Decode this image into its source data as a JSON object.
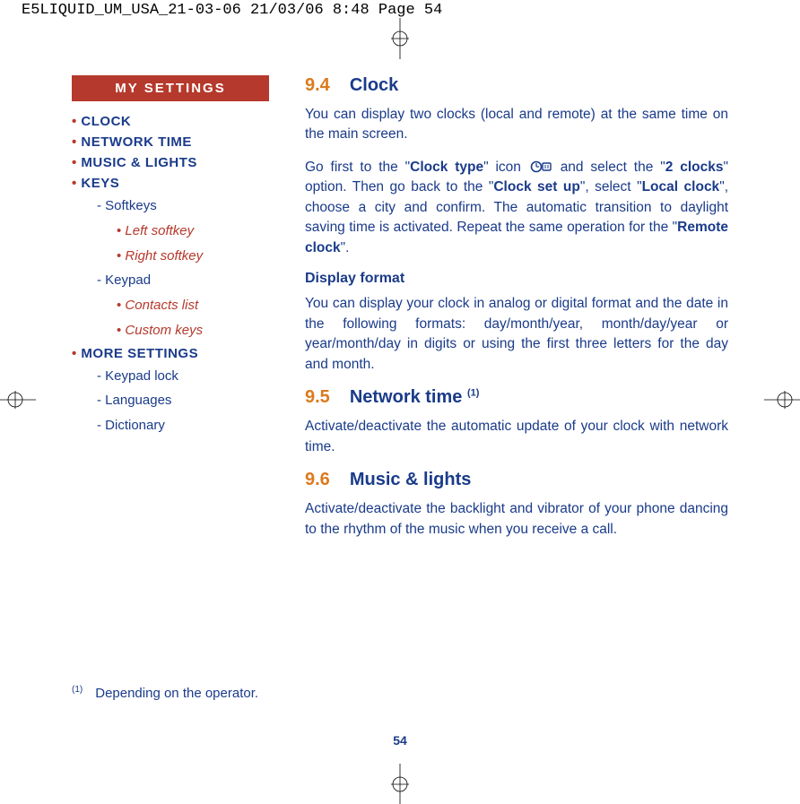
{
  "header_line": "E5LIQUID_UM_USA_21-03-06  21/03/06  8:48  Page 54",
  "sidebar": {
    "tab": "MY SETTINGS",
    "items": [
      {
        "label": "CLOCK",
        "level": 1
      },
      {
        "label": "NETWORK TIME",
        "level": 1
      },
      {
        "label": "MUSIC & LIGHTS",
        "level": 1
      },
      {
        "label": "KEYS",
        "level": 1
      },
      {
        "label": "Softkeys",
        "level": 2
      },
      {
        "label": "Left softkey",
        "level": 3
      },
      {
        "label": "Right softkey",
        "level": 3
      },
      {
        "label": "Keypad",
        "level": 2
      },
      {
        "label": "Contacts list",
        "level": 3
      },
      {
        "label": "Custom keys",
        "level": 3
      },
      {
        "label": "MORE SETTINGS",
        "level": 1
      },
      {
        "label": "Keypad lock",
        "level": 2
      },
      {
        "label": "Languages",
        "level": 2
      },
      {
        "label": "Dictionary",
        "level": 2
      }
    ]
  },
  "sections": {
    "s94": {
      "num": "9.4",
      "title": "Clock",
      "p1": "You can display two clocks (local and remote) at the same time on the main screen.",
      "p2a": "Go first to the \"",
      "p2b": "Clock type",
      "p2c": "\" icon ",
      "p2d": " and select the \"",
      "p2e": "2 clocks",
      "p2f": "\" option. Then go back to the \"",
      "p2g": "Clock set up",
      "p2h": "\", select \"",
      "p2i": "Local clock",
      "p2j": "\", choose a city and confirm. The automatic transition to daylight saving time is activated. Repeat the same operation for the \"",
      "p2k": "Remote clock",
      "p2l": "\".",
      "h3": "Display format",
      "p3": "You can display your clock in analog or digital format and the date in the following formats: day/month/year, month/day/year or year/month/day in digits or using the first three letters for the day and month."
    },
    "s95": {
      "num": "9.5",
      "title": "Network time ",
      "sup": "(1)",
      "p1": "Activate/deactivate the automatic update of your clock with network time."
    },
    "s96": {
      "num": "9.6",
      "title": "Music & lights",
      "p1": "Activate/deactivate the backlight and vibrator of your phone dancing to the rhythm of the music when you receive a call."
    }
  },
  "footnote": {
    "mark": "(1)",
    "text": "Depending on the operator."
  },
  "page_number": "54",
  "icon_name": "clock-type-icon"
}
